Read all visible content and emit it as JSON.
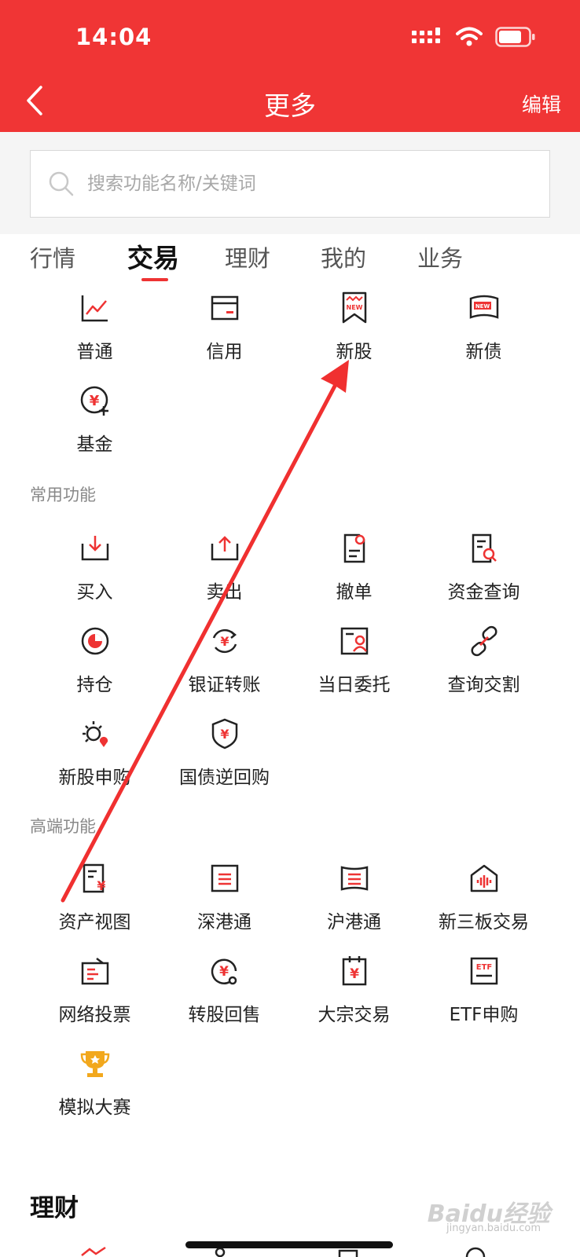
{
  "status": {
    "time": "14:04"
  },
  "nav": {
    "title": "更多",
    "edit": "编辑"
  },
  "search": {
    "placeholder": "搜索功能名称/关键词"
  },
  "tabs": [
    {
      "label": "行情"
    },
    {
      "label": "交易"
    },
    {
      "label": "理财"
    },
    {
      "label": "我的"
    },
    {
      "label": "业务"
    }
  ],
  "trade": {
    "items": [
      {
        "label": "普通",
        "icon": "line-chart-icon"
      },
      {
        "label": "信用",
        "icon": "card-icon"
      },
      {
        "label": "新股",
        "icon": "new-stock-icon"
      },
      {
        "label": "新债",
        "icon": "new-bond-icon"
      },
      {
        "label": "基金",
        "icon": "fund-icon"
      }
    ]
  },
  "common": {
    "label": "常用功能",
    "items": [
      {
        "label": "买入",
        "icon": "buy-icon"
      },
      {
        "label": "卖出",
        "icon": "sell-icon"
      },
      {
        "label": "撤单",
        "icon": "cancel-order-icon"
      },
      {
        "label": "资金查询",
        "icon": "fund-query-icon"
      },
      {
        "label": "持仓",
        "icon": "position-icon"
      },
      {
        "label": "银证转账",
        "icon": "transfer-icon"
      },
      {
        "label": "当日委托",
        "icon": "today-order-icon"
      },
      {
        "label": "查询交割",
        "icon": "settlement-icon"
      },
      {
        "label": "新股申购",
        "icon": "ipo-subscribe-icon"
      },
      {
        "label": "国债逆回购",
        "icon": "reverse-repo-icon"
      }
    ]
  },
  "advanced": {
    "label": "高端功能",
    "items": [
      {
        "label": "资产视图",
        "icon": "asset-view-icon"
      },
      {
        "label": "深港通",
        "icon": "shenzhen-hk-icon"
      },
      {
        "label": "沪港通",
        "icon": "shanghai-hk-icon"
      },
      {
        "label": "新三板交易",
        "icon": "neeq-icon"
      },
      {
        "label": "网络投票",
        "icon": "online-vote-icon"
      },
      {
        "label": "转股回售",
        "icon": "convert-sellback-icon"
      },
      {
        "label": "大宗交易",
        "icon": "block-trade-icon"
      },
      {
        "label": "ETF申购",
        "icon": "etf-icon"
      },
      {
        "label": "模拟大赛",
        "icon": "trophy-icon"
      }
    ]
  },
  "licai": {
    "heading": "理财"
  },
  "watermark": {
    "brand": "Baidu经验",
    "url": "jingyan.baidu.com"
  },
  "colors": {
    "brand": "#f03535",
    "accent": "#e33333"
  }
}
